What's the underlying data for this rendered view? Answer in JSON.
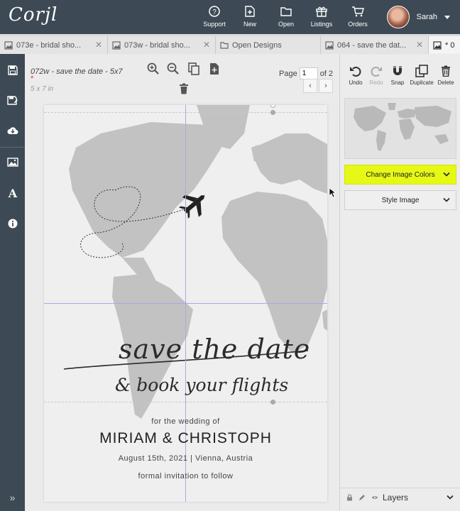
{
  "app": {
    "logo": "Corjl",
    "user_name": "Sarah"
  },
  "topnav": [
    {
      "label": "Support",
      "icon": "help-circle-icon"
    },
    {
      "label": "New",
      "icon": "new-file-icon"
    },
    {
      "label": "Open",
      "icon": "folder-icon"
    },
    {
      "label": "Listings",
      "icon": "gift-box-icon"
    },
    {
      "label": "Orders",
      "icon": "cart-icon"
    }
  ],
  "tabs": [
    {
      "label": "073e - bridal sho...",
      "icon": "image-icon",
      "active": false
    },
    {
      "label": "073w - bridal sho...",
      "icon": "image-icon",
      "active": false
    },
    {
      "label": "Open Designs",
      "icon": "folder-icon",
      "active": false
    },
    {
      "label": "064 - save the dat...",
      "icon": "image-icon",
      "active": false
    },
    {
      "label": "* 0",
      "icon": "image-icon",
      "active": true
    }
  ],
  "left_tools": [
    "save-icon",
    "save-as-icon",
    "download-icon",
    "image-icon",
    "text-icon",
    "info-icon"
  ],
  "left_expand": "»",
  "document": {
    "name": "072w - save the date - 5x7",
    "required_mark": "*",
    "size": "5 x 7 in",
    "page_label": "Page",
    "page_value": "1",
    "page_total": "of 2",
    "prev": "‹",
    "next": "›"
  },
  "design": {
    "script_line1": "save the date",
    "script_line2": "& book your flights",
    "for_text": "for the wedding of",
    "names": "MIRIAM & CHRISTOPH",
    "date_place": "August 15th, 2021 | Vienna, Austria",
    "formal": "formal invitation to follow"
  },
  "right_tools": [
    {
      "label": "Undo",
      "icon": "undo-icon",
      "enabled": true
    },
    {
      "label": "Redo",
      "icon": "redo-icon",
      "enabled": false
    },
    {
      "label": "Snap",
      "icon": "magnet-icon",
      "enabled": true
    },
    {
      "label": "Duplicate",
      "icon": "duplicate-icon",
      "enabled": true
    },
    {
      "label": "Delete",
      "icon": "trash-icon",
      "enabled": true
    }
  ],
  "panel": {
    "change_colors": "Change Image Colors",
    "style_image": "Style Image",
    "layers": "Layers"
  },
  "colors": {
    "topbar": "#3d4a55",
    "highlight": "#e6f815",
    "map": "#c2c2c2"
  }
}
